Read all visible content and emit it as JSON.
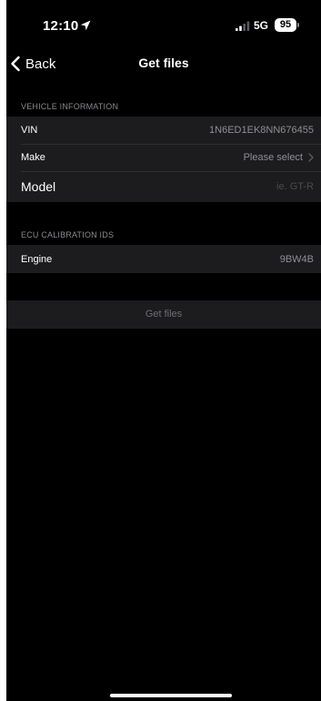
{
  "status_bar": {
    "time": "12:10",
    "location_icon": "location-arrow-icon",
    "signal_icon": "cellular-signal-icon",
    "network": "5G",
    "battery": "95"
  },
  "nav": {
    "back_icon": "chevron-left-icon",
    "back_label": "Back",
    "title": "Get files"
  },
  "vehicle_information": {
    "header": "VEHICLE INFORMATION",
    "vin": {
      "label": "VIN",
      "value": "1N6ED1EK8NN676455"
    },
    "make": {
      "label": "Make",
      "value": "Please select",
      "icon": "chevron-right-icon"
    },
    "model": {
      "label": "Model",
      "value": "",
      "placeholder": "ie. GT-R"
    }
  },
  "ecu_calibration": {
    "header": "ECU CALIBRATION IDS",
    "engine": {
      "label": "Engine",
      "value": "9BW4B"
    }
  },
  "actions": {
    "get_files_label": "Get files"
  },
  "colors": {
    "background": "#000000",
    "cell_background": "#1c1c1e",
    "secondary_text": "#8e8e93",
    "section_header": "#8a8a8e"
  }
}
